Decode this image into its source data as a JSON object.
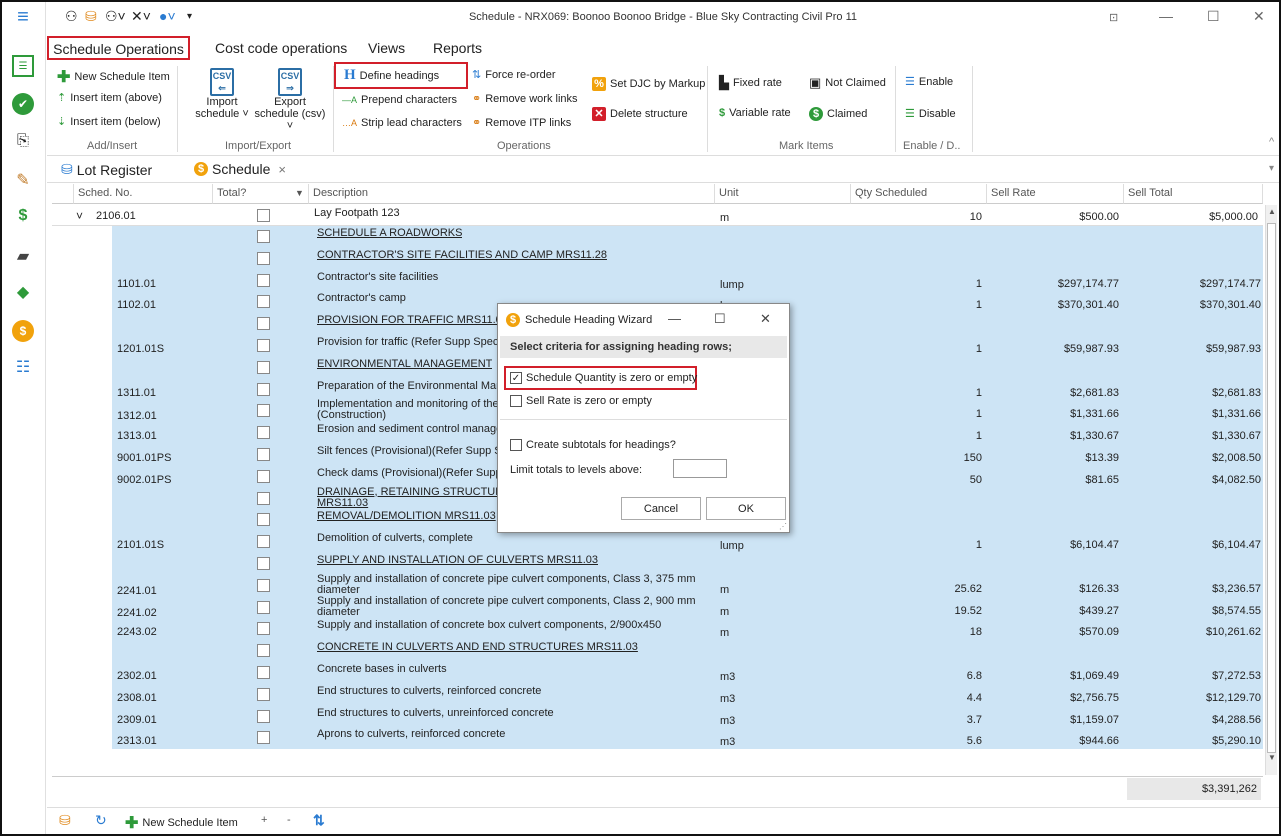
{
  "app": {
    "title": "Schedule - NRX069: Boonoo Boonoo Bridge - Blue Sky Contracting Civil Pro 11"
  },
  "menu_tabs": [
    "Schedule Operations",
    "Cost code operations",
    "Views",
    "Reports"
  ],
  "ribbon": {
    "add_insert": {
      "new_item": "New Schedule Item",
      "insert_above": "Insert item (above)",
      "insert_below": "Insert item (below)",
      "label": "Add/Insert"
    },
    "import_export": {
      "import_l1": "Import",
      "import_l2": "schedule ˅",
      "export_l1": "Export",
      "export_l2": "schedule (csv) ˅",
      "label": "Import/Export"
    },
    "operations": {
      "define_headings": "Define headings",
      "prepend": "Prepend characters",
      "strip": "Strip lead characters",
      "force_reorder": "Force re-order",
      "remove_work": "Remove work links",
      "remove_itp": "Remove ITP links",
      "set_djc": "Set DJC by Markup",
      "delete_structure": "Delete structure",
      "label": "Operations"
    },
    "mark_items": {
      "fixed_rate": "Fixed rate",
      "variable_rate": "Variable rate",
      "not_claimed": "Not Claimed",
      "claimed": "Claimed",
      "label": "Mark Items"
    },
    "enable_disable": {
      "enable": "Enable",
      "disable": "Disable",
      "label": "Enable / D.."
    }
  },
  "doc_tabs": {
    "lot_register": "Lot Register",
    "schedule": "Schedule",
    "close": "×"
  },
  "grid": {
    "headers": [
      "Sched. No.",
      "Total?",
      "Description",
      "Unit",
      "Qty Scheduled",
      "Sell Rate",
      "Sell Total"
    ],
    "group_row": {
      "no": "2106.01",
      "desc": "Lay Footpath 123",
      "unit": "m",
      "qty": "10",
      "rate": "$500.00",
      "total": "$5,000.00"
    },
    "rows": [
      {
        "no": "",
        "desc": "SCHEDULE A ROADWORKS",
        "heading": true,
        "unit": "",
        "qty": "",
        "rate": "",
        "total": ""
      },
      {
        "no": "",
        "desc": "CONTRACTOR'S SITE FACILITIES AND CAMP  MRS11.28",
        "heading": true,
        "unit": "",
        "qty": "",
        "rate": "",
        "total": ""
      },
      {
        "no": "1101.01",
        "desc": "Contractor's site facilities",
        "unit": "lump",
        "qty": "1",
        "rate": "$297,174.77",
        "total": "$297,174.77"
      },
      {
        "no": "1102.01",
        "desc": "Contractor's camp",
        "unit": "lump",
        "qty": "1",
        "rate": "$370,301.40",
        "total": "$370,301.40"
      },
      {
        "no": "",
        "desc": "PROVISION FOR TRAFFIC  MRS11.0",
        "heading": true,
        "unit": "",
        "qty": "",
        "rate": "",
        "total": ""
      },
      {
        "no": "1201.01S",
        "desc": "Provision for traffic (Refer Supp Spec",
        "unit": "",
        "qty": "1",
        "rate": "$59,987.93",
        "total": "$59,987.93"
      },
      {
        "no": "",
        "desc": "ENVIRONMENTAL MANAGEMENT",
        "heading": true,
        "unit": "",
        "qty": "",
        "rate": "",
        "total": ""
      },
      {
        "no": "1311.01",
        "desc": "Preparation of the Environmental Man",
        "unit": "",
        "qty": "1",
        "rate": "$2,681.83",
        "total": "$2,681.83"
      },
      {
        "no": "1312.01",
        "desc": "Implementation and monitoring of the E",
        "desc2": "(Construction)",
        "unit": "",
        "qty": "1",
        "rate": "$1,331.66",
        "total": "$1,331.66"
      },
      {
        "no": "1313.01",
        "desc": "Erosion and sediment control manage",
        "unit": "",
        "qty": "1",
        "rate": "$1,330.67",
        "total": "$1,330.67"
      },
      {
        "no": "9001.01PS",
        "desc": "Silt fences (Provisional)(Refer Supp S",
        "unit": "",
        "qty": "150",
        "rate": "$13.39",
        "total": "$2,008.50"
      },
      {
        "no": "9002.01PS",
        "desc": "Check dams (Provisional)(Refer Supp",
        "unit": "",
        "qty": "50",
        "rate": "$81.65",
        "total": "$4,082.50"
      },
      {
        "no": "",
        "desc": "DRAINAGE, RETAINING STRUCTUR",
        "desc2": "MRS11.03",
        "heading": true,
        "unit": "",
        "qty": "",
        "rate": "",
        "total": ""
      },
      {
        "no": "",
        "desc": "REMOVAL/DEMOLITION  MRS11.03",
        "heading": true,
        "unit": "",
        "qty": "",
        "rate": "",
        "total": ""
      },
      {
        "no": "2101.01S",
        "desc": "Demolition of culverts, complete",
        "unit": "lump",
        "qty": "1",
        "rate": "$6,104.47",
        "total": "$6,104.47"
      },
      {
        "no": "",
        "desc": "SUPPLY AND INSTALLATION OF CULVERTS  MRS11.03",
        "heading": true,
        "unit": "",
        "qty": "",
        "rate": "",
        "total": ""
      },
      {
        "no": "2241.01",
        "desc": "Supply and installation of concrete pipe culvert components, Class 3, 375 mm",
        "desc2": "diameter",
        "unit": "m",
        "qty": "25.62",
        "rate": "$126.33",
        "total": "$3,236.57"
      },
      {
        "no": "2241.02",
        "desc": "Supply and installation of concrete pipe culvert components, Class 2, 900 mm",
        "desc2": "diameter",
        "unit": "m",
        "qty": "19.52",
        "rate": "$439.27",
        "total": "$8,574.55"
      },
      {
        "no": "2243.02",
        "desc": "Supply and installation of concrete box culvert components, 2/900x450",
        "unit": "m",
        "qty": "18",
        "rate": "$570.09",
        "total": "$10,261.62"
      },
      {
        "no": "",
        "desc": "CONCRETE IN CULVERTS AND END STRUCTURES  MRS11.03",
        "heading": true,
        "unit": "",
        "qty": "",
        "rate": "",
        "total": ""
      },
      {
        "no": "2302.01",
        "desc": "Concrete bases in culverts",
        "unit": "m3",
        "qty": "6.8",
        "rate": "$1,069.49",
        "total": "$7,272.53"
      },
      {
        "no": "2308.01",
        "desc": "End structures to culverts, reinforced concrete",
        "unit": "m3",
        "qty": "4.4",
        "rate": "$2,756.75",
        "total": "$12,129.70"
      },
      {
        "no": "2309.01",
        "desc": "End structures to culverts, unreinforced concrete",
        "unit": "m3",
        "qty": "3.7",
        "rate": "$1,159.07",
        "total": "$4,288.56"
      },
      {
        "no": "2313.01",
        "desc": "Aprons to culverts, reinforced concrete",
        "unit": "m3",
        "qty": "5.6",
        "rate": "$944.66",
        "total": "$5,290.10"
      }
    ],
    "grand_total": "$3,391,262"
  },
  "dialog": {
    "title": "Schedule Heading Wizard",
    "subtitle": "Select criteria for assigning heading rows;",
    "opt1": "Schedule Quantity is zero or empty",
    "opt2": "Sell Rate is zero or empty",
    "opt3": "Create subtotals for headings?",
    "limit_label": "Limit totals to levels above:",
    "cancel": "Cancel",
    "ok": "OK"
  },
  "bottombar": {
    "new_item": "New Schedule Item",
    "plus": "+",
    "minus": "-"
  },
  "colors": {
    "selected_row": "#cde4f5",
    "accent_red": "#d21f2a",
    "green": "#2e9a3a"
  }
}
